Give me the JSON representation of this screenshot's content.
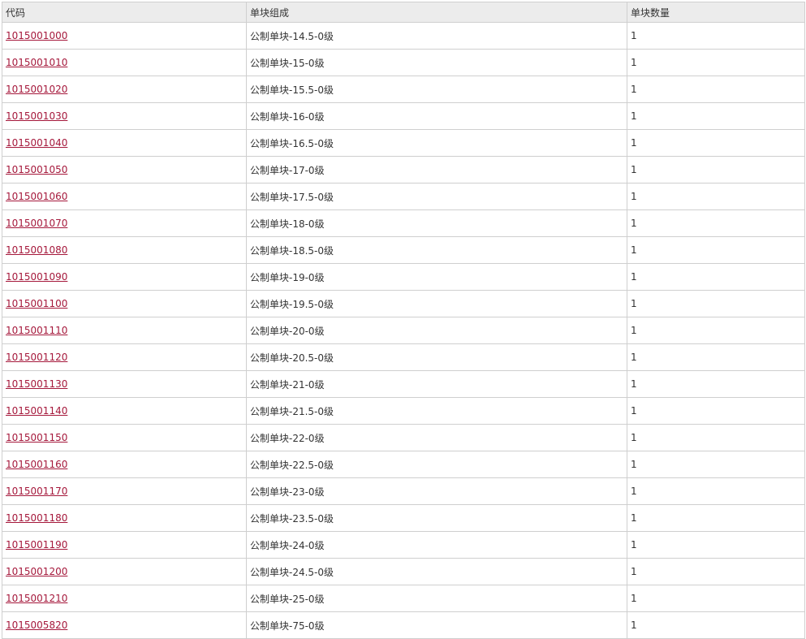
{
  "table": {
    "headers": [
      "代码",
      "单块组成",
      "单块数量"
    ],
    "rows": [
      {
        "code": "1015001000",
        "composition": "公制单块-14.5-0级",
        "quantity": "1"
      },
      {
        "code": "1015001010",
        "composition": "公制单块-15-0级",
        "quantity": "1"
      },
      {
        "code": "1015001020",
        "composition": "公制单块-15.5-0级",
        "quantity": "1"
      },
      {
        "code": "1015001030",
        "composition": "公制单块-16-0级",
        "quantity": "1"
      },
      {
        "code": "1015001040",
        "composition": "公制单块-16.5-0级",
        "quantity": "1"
      },
      {
        "code": "1015001050",
        "composition": "公制单块-17-0级",
        "quantity": "1"
      },
      {
        "code": "1015001060",
        "composition": "公制单块-17.5-0级",
        "quantity": "1"
      },
      {
        "code": "1015001070",
        "composition": "公制单块-18-0级",
        "quantity": "1"
      },
      {
        "code": "1015001080",
        "composition": "公制单块-18.5-0级",
        "quantity": "1"
      },
      {
        "code": "1015001090",
        "composition": "公制单块-19-0级",
        "quantity": "1"
      },
      {
        "code": "1015001100",
        "composition": "公制单块-19.5-0级",
        "quantity": "1"
      },
      {
        "code": "1015001110",
        "composition": "公制单块-20-0级",
        "quantity": "1"
      },
      {
        "code": "1015001120",
        "composition": "公制单块-20.5-0级",
        "quantity": "1"
      },
      {
        "code": "1015001130",
        "composition": "公制单块-21-0级",
        "quantity": "1"
      },
      {
        "code": "1015001140",
        "composition": "公制单块-21.5-0级",
        "quantity": "1"
      },
      {
        "code": "1015001150",
        "composition": "公制单块-22-0级",
        "quantity": "1"
      },
      {
        "code": "1015001160",
        "composition": "公制单块-22.5-0级",
        "quantity": "1"
      },
      {
        "code": "1015001170",
        "composition": "公制单块-23-0级",
        "quantity": "1"
      },
      {
        "code": "1015001180",
        "composition": "公制单块-23.5-0级",
        "quantity": "1"
      },
      {
        "code": "1015001190",
        "composition": "公制单块-24-0级",
        "quantity": "1"
      },
      {
        "code": "1015001200",
        "composition": "公制单块-24.5-0级",
        "quantity": "1"
      },
      {
        "code": "1015001210",
        "composition": "公制单块-25-0级",
        "quantity": "1"
      },
      {
        "code": "1015005820",
        "composition": "公制单块-75-0级",
        "quantity": "1"
      }
    ]
  },
  "colors": {
    "link": "#a5183b",
    "header_bg": "#ececec",
    "border": "#cfcfcf"
  }
}
